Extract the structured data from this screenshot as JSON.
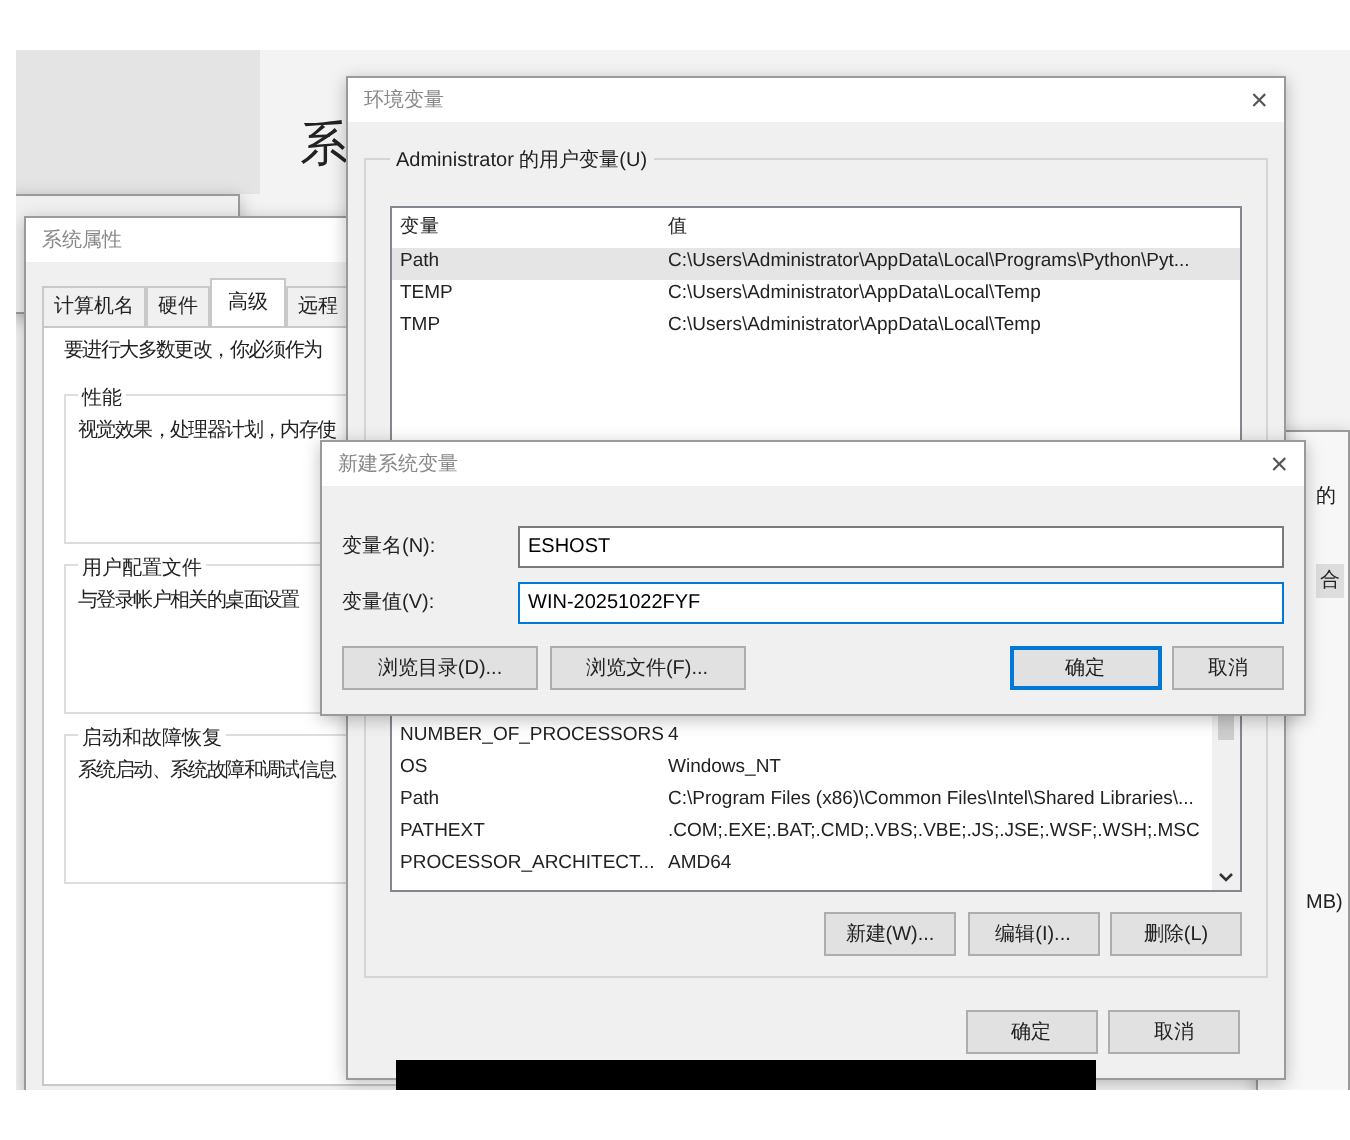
{
  "background_heading": "系",
  "system_properties": {
    "title": "系统属性",
    "tabs": [
      {
        "label": "计算机名",
        "selected": false
      },
      {
        "label": "硬件",
        "selected": false
      },
      {
        "label": "高级",
        "selected": true
      },
      {
        "label": "远程",
        "selected": false
      }
    ],
    "intro": "要进行大多数更改，你必须作为",
    "groups": [
      {
        "title": "性能",
        "text": "视觉效果，处理器计划，内存使"
      },
      {
        "title": "用户配置文件",
        "text": "与登录帐户相关的桌面设置"
      },
      {
        "title": "启动和故障恢复",
        "text": "系统启动、系统故障和调试信息"
      }
    ]
  },
  "environment_variables": {
    "title": "环境变量",
    "close": "×",
    "user_group_label": "Administrator 的用户变量(U)",
    "user_columns": [
      "变量",
      "值"
    ],
    "user_rows": [
      {
        "name": "Path",
        "value": "C:\\Users\\Administrator\\AppData\\Local\\Programs\\Python\\Pyt...",
        "selected": true
      },
      {
        "name": "TEMP",
        "value": "C:\\Users\\Administrator\\AppData\\Local\\Temp",
        "selected": false
      },
      {
        "name": "TMP",
        "value": "C:\\Users\\Administrator\\AppData\\Local\\Temp",
        "selected": false
      }
    ],
    "system_rows": [
      {
        "name": "NUMBER_OF_PROCESSORS",
        "value": "4",
        "selected": false
      },
      {
        "name": "OS",
        "value": "Windows_NT",
        "selected": false
      },
      {
        "name": "Path",
        "value": "C:\\Program Files (x86)\\Common Files\\Intel\\Shared Libraries\\...",
        "selected": false
      },
      {
        "name": "PATHEXT",
        "value": ".COM;.EXE;.BAT;.CMD;.VBS;.VBE;.JS;.JSE;.WSF;.WSH;.MSC",
        "selected": false
      },
      {
        "name": "PROCESSOR_ARCHITECT...",
        "value": "AMD64",
        "selected": false
      }
    ],
    "system_buttons": [
      "新建(W)...",
      "编辑(I)...",
      "删除(L)"
    ],
    "buttons": [
      "确定",
      "取消"
    ]
  },
  "new_variable_dialog": {
    "title": "新建系统变量",
    "close": "×",
    "fields": [
      {
        "label": "变量名(N):",
        "value": "ESHOST"
      },
      {
        "label": "变量值(V):",
        "value": "WIN-20251022FYF"
      }
    ],
    "buttons": [
      {
        "label": "浏览目录(D)...",
        "default": false
      },
      {
        "label": "浏览文件(F)...",
        "default": false
      },
      {
        "label": "确定",
        "default": true
      },
      {
        "label": "取消",
        "default": false
      }
    ]
  },
  "background_fragments": [
    "的",
    "合",
    "MB)"
  ]
}
